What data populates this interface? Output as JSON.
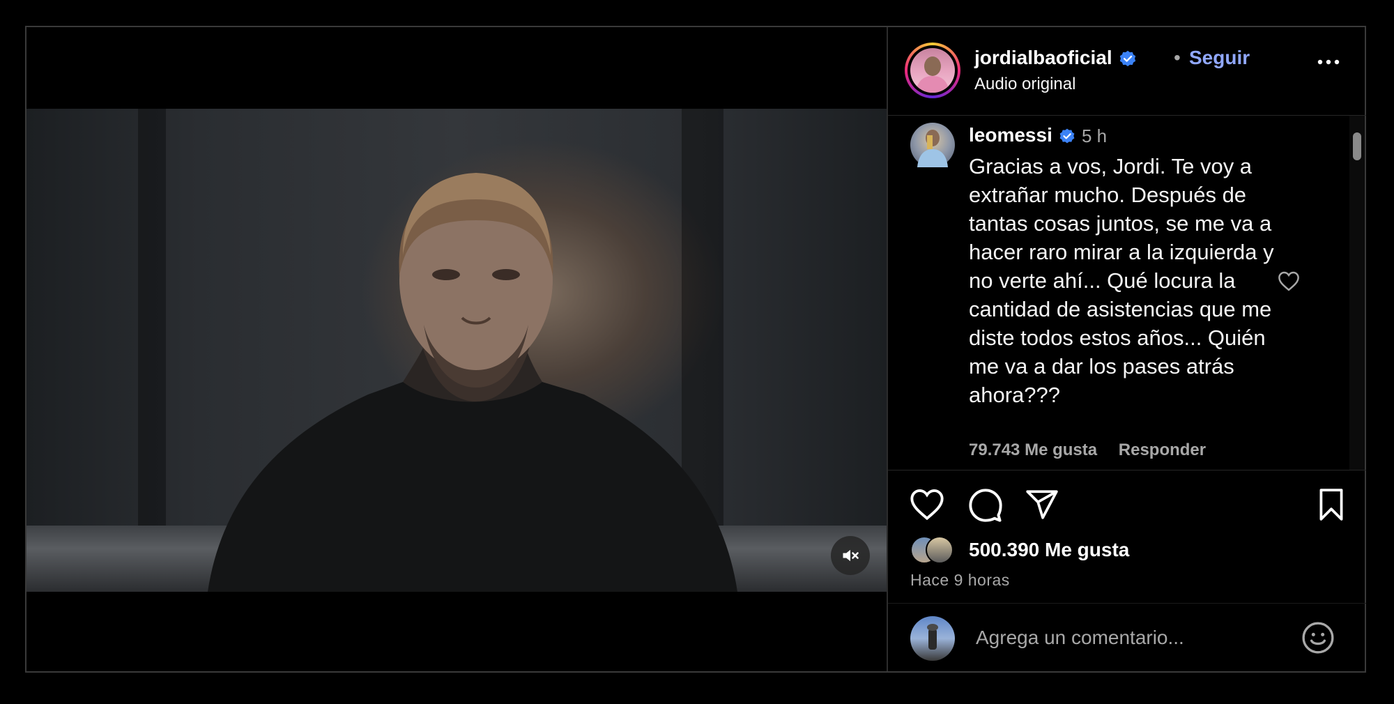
{
  "post": {
    "username": "jordialbaoficial",
    "separator": "•",
    "follow_label": "Seguir",
    "audio_label": "Audio original"
  },
  "comment": {
    "username": "leomessi",
    "time": "5 h",
    "text": "Gracias a vos, Jordi. Te voy a extrañar mucho. Después de tantas cosas juntos, se me va a hacer raro mirar a la izquierda y no verte ahí... Qué locura la cantidad de asistencias que me diste todos estos años... Quién me va a dar los pases atrás ahora???",
    "likes": "79.743 Me gusta",
    "reply_label": "Responder"
  },
  "stats": {
    "likes": "500.390 Me gusta",
    "ago": "Hace 9 horas"
  },
  "add_comment": {
    "placeholder": "Agrega un comentario..."
  },
  "icons": {
    "verified": "verified-badge-icon",
    "more": "more-options-icon",
    "heart": "heart-icon",
    "comment": "comment-icon",
    "share": "share-icon",
    "save": "bookmark-icon",
    "mute": "muted-speaker-icon",
    "emoji": "emoji-icon"
  },
  "colors": {
    "follow": "#91a8ff",
    "verified": "#3b82f6",
    "background": "#000000",
    "muted_text": "#a8a8a8"
  }
}
